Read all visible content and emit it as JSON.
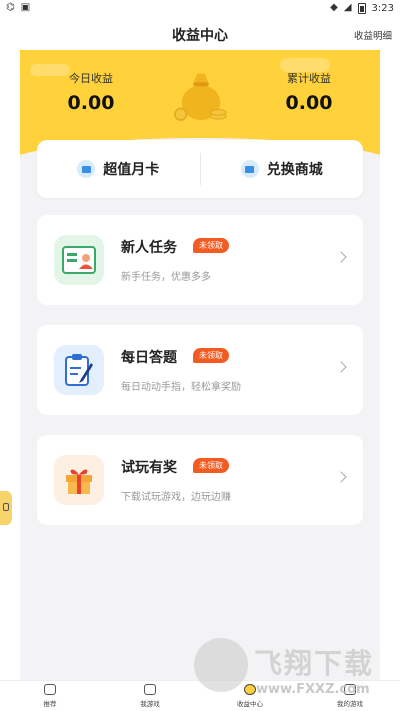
{
  "status_bar": {
    "left_icons": [
      "carrier-icon",
      "notification-icon"
    ],
    "time": "3:23"
  },
  "header": {
    "title": "收益中心",
    "details_link": "收益明细"
  },
  "earnings": {
    "today_label": "今日收益",
    "today_value": "0.00",
    "total_label": "累计收益",
    "total_value": "0.00"
  },
  "tabs": [
    {
      "label": "超值月卡",
      "icon": "card-icon"
    },
    {
      "label": "兑换商城",
      "icon": "shop-icon"
    }
  ],
  "tasks": [
    {
      "title": "新人任务",
      "badge": "未领取",
      "desc": "新手任务，优惠多多",
      "icon": "id-card-icon"
    },
    {
      "title": "每日答题",
      "badge": "未领取",
      "desc": "每日动动手指，轻松拿奖励",
      "icon": "clipboard-pen-icon"
    },
    {
      "title": "试玩有奖",
      "badge": "未领取",
      "desc": "下载试玩游戏，边玩边赚",
      "icon": "gift-icon"
    }
  ],
  "bottom_nav": [
    {
      "label": "推荐",
      "icon": "home-icon"
    },
    {
      "label": "我游戏",
      "icon": "gamepad-icon"
    },
    {
      "label": "收益中心",
      "icon": "coin-icon",
      "active": true
    },
    {
      "label": "我的游戏",
      "icon": "user-icon"
    }
  ],
  "watermark": {
    "text": "飞翔下载",
    "url": "www.FXXZ.com"
  },
  "colors": {
    "accent_yellow": "#ffd13a",
    "badge_orange": "#f25b22",
    "page_bg": "#f3f3f5"
  }
}
